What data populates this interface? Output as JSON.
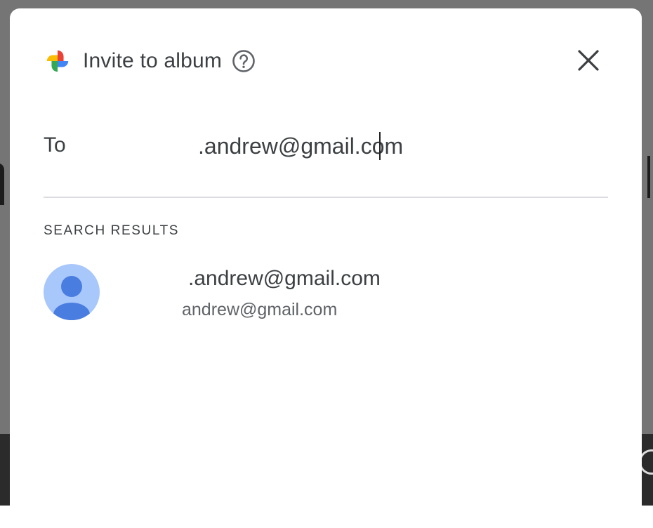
{
  "dialog": {
    "title": "Invite to album",
    "logo_icon": "google-photos-pinwheel-icon",
    "help_icon": "help-circle-icon",
    "close_icon": "close-icon"
  },
  "to_field": {
    "label": "To",
    "value": ".andrew@gmail.com"
  },
  "search_results": {
    "heading": "SEARCH RESULTS",
    "items": [
      {
        "name": ".andrew@gmail.com",
        "email": "andrew@gmail.com",
        "avatar_icon": "person-avatar-icon"
      }
    ]
  },
  "colors": {
    "text_primary": "#3c4043",
    "text_secondary": "#5f6368",
    "divider": "#dadce0",
    "avatar_bg": "#a8c7fa",
    "avatar_fg": "#4a7de0",
    "scrim": "#757575"
  }
}
